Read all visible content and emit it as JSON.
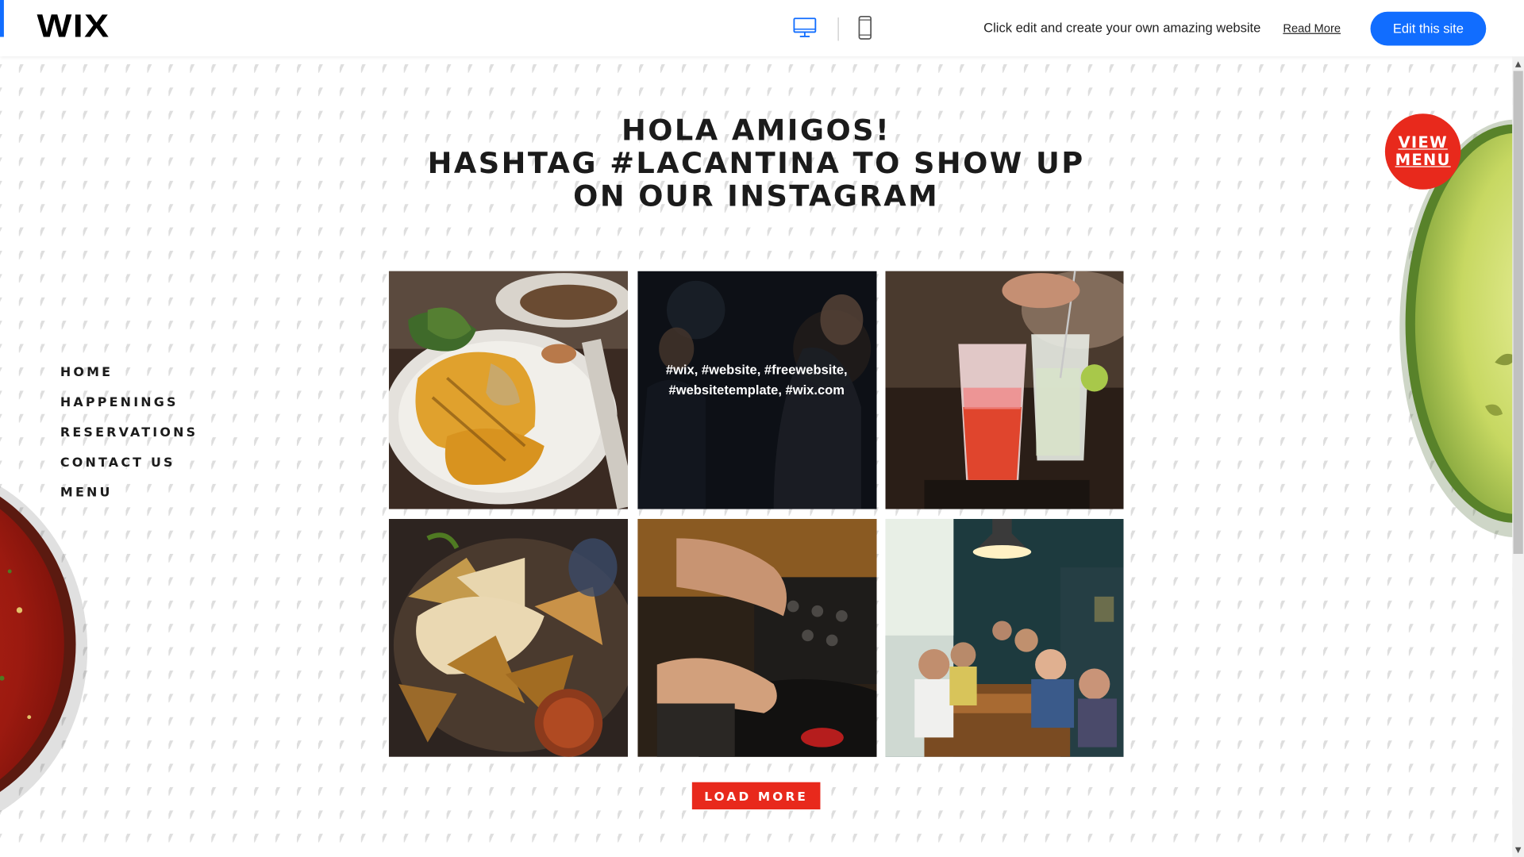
{
  "topbar": {
    "logo": "WIX",
    "desktop_icon": "desktop-icon",
    "mobile_icon": "mobile-icon",
    "message": "Click edit and create your own amazing website",
    "read_more": "Read More",
    "edit_button": "Edit this site",
    "accent_color": "#116dff"
  },
  "headline": {
    "line1": "HOLA AMIGOS!",
    "line2": "HASHTAG #LACANTINA TO SHOW UP",
    "line3": "ON OUR INSTAGRAM"
  },
  "nav": {
    "items": [
      {
        "label": "HOME"
      },
      {
        "label": "HAPPENINGS"
      },
      {
        "label": "RESERVATIONS"
      },
      {
        "label": "CONTACT US"
      },
      {
        "label": "MENU"
      }
    ]
  },
  "gallery": {
    "tiles": [
      {
        "icon": "burrito-photo"
      },
      {
        "icon": "party-photo",
        "caption": "#wix, #website, #freewebsite, #websitetemplate, #wix.com"
      },
      {
        "icon": "drinks-photo"
      },
      {
        "icon": "nachos-photo"
      },
      {
        "icon": "dj-turntable-photo"
      },
      {
        "icon": "restaurant-diners-photo"
      }
    ]
  },
  "load_more": "LOAD MORE",
  "view_menu": {
    "line1": "VIEW",
    "line2": "MENU",
    "color": "#e8291c"
  }
}
